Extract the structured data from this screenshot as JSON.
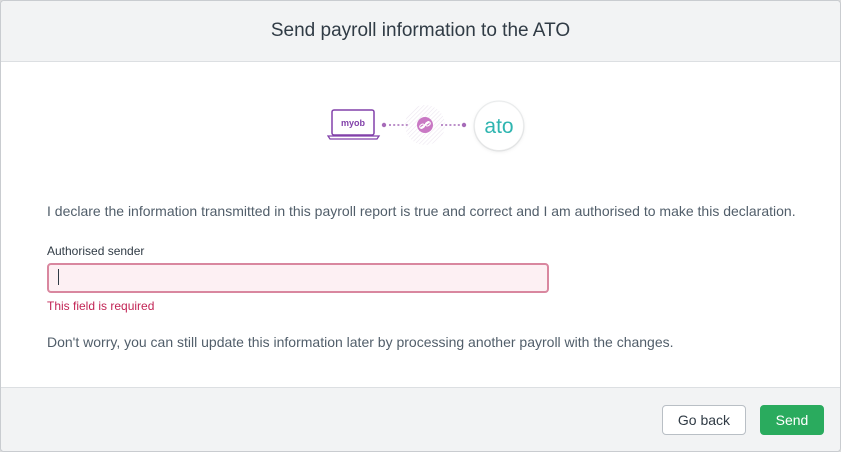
{
  "dialog": {
    "title": "Send payroll information to the ATO"
  },
  "illustration": {
    "left_logo_text": "myob",
    "right_logo_text": "ato",
    "link_icon": "link-icon",
    "colors": {
      "myob_purple": "#8241aa",
      "ato_teal": "#2fb5b0",
      "link_pink": "#c978c4"
    }
  },
  "body": {
    "declaration": "I declare the information transmitted in this payroll report is true and correct and I am authorised to make this declaration.",
    "sender_field": {
      "label": "Authorised sender",
      "value": "",
      "error": "This field is required"
    },
    "note": "Don't worry, you can still update this information later by processing another payroll with the changes."
  },
  "footer": {
    "back_label": "Go back",
    "send_label": "Send"
  },
  "colors": {
    "error": "#c22455",
    "primary": "#2aab5e"
  }
}
